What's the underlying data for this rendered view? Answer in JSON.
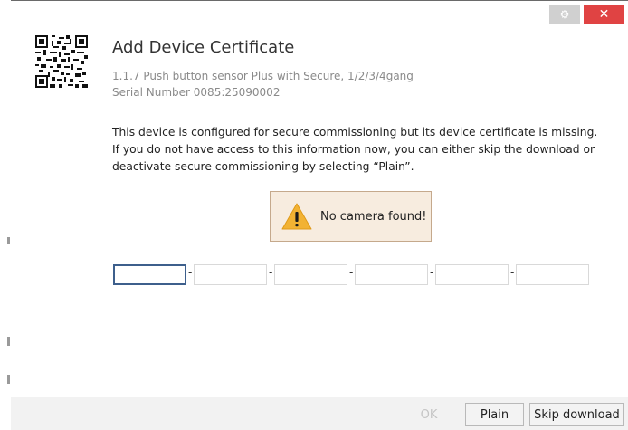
{
  "window": {
    "settings_glyph": "⚙",
    "close_glyph": "✕",
    "settings_icon": "gear-icon",
    "close_icon": "close-icon"
  },
  "header": {
    "title": "Add Device Certificate",
    "device_name": "1.1.7 Push button sensor Plus with Secure, 1/2/3/4gang",
    "serial_number": "Serial Number 0085:25090002",
    "qr_icon": "qr-code-icon"
  },
  "message": {
    "lines": [
      "This device is configured for secure commissioning but its device certificate is missing.",
      "If you do not have access to this information now, you can either skip the download or",
      "deactivate secure commissioning by selecting “Plain”."
    ]
  },
  "warning": {
    "text": "No camera found!",
    "icon": "warning-icon",
    "color": "#f2b233"
  },
  "certificate": {
    "fields": [
      "",
      "",
      "",
      "",
      "",
      ""
    ],
    "separator": "-"
  },
  "footer": {
    "ok_label": "OK",
    "plain_label": "Plain",
    "skip_label": "Skip download"
  },
  "colors": {
    "close_button": "#e04343",
    "focus_border": "#3d5f8c",
    "warning_background": "#f7ecdf"
  }
}
